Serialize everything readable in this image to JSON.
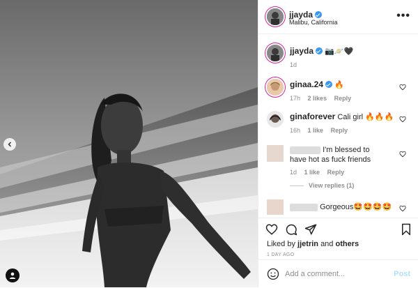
{
  "post": {
    "username": "jjayda",
    "location": "Malibu, California",
    "caption_emoji": "📷🪐🖤",
    "caption_time": "1d",
    "more_label": "•••",
    "liked_by_prefix": "Liked by",
    "liked_by_user": "jjetrin",
    "liked_by_and": "and",
    "liked_by_others": "others",
    "posted_ago": "1 DAY AGO",
    "add_comment_placeholder": "Add a comment...",
    "post_label": "Post"
  },
  "comments": [
    {
      "username": "ginaa.24",
      "text": "🔥",
      "time": "17h",
      "likes": "2 likes",
      "reply": "Reply"
    },
    {
      "username": "ginaforever",
      "text": "Cali girl 🔥🔥🔥",
      "time": "16h",
      "likes": "1 like",
      "reply": "Reply"
    },
    {
      "username": "",
      "text": "I'm blessed to have hot as fuck friends",
      "time": "1d",
      "likes": "1 like",
      "reply": "Reply",
      "view_replies": "View replies (1)"
    },
    {
      "username": "",
      "text": "Gorgeous🤩🤩🤩🤩"
    }
  ],
  "colors": {
    "verified": "#3897f0",
    "ring": "#d6249f",
    "muted": "#8e8e8e"
  }
}
